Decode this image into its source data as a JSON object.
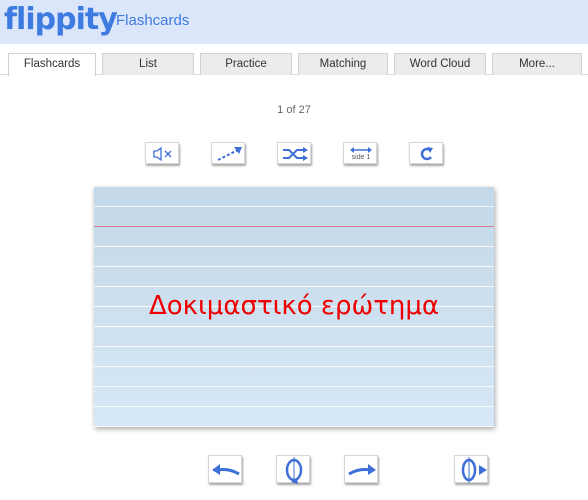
{
  "header": {
    "logo": "flippity",
    "title": "Flashcards"
  },
  "tabs": [
    {
      "label": "Flashcards",
      "active": true
    },
    {
      "label": "List"
    },
    {
      "label": "Practice"
    },
    {
      "label": "Matching"
    },
    {
      "label": "Word Cloud"
    },
    {
      "label": "More..."
    }
  ],
  "counter": "1 of 27",
  "toolbar": {
    "mute_icon": "speaker-mute-icon",
    "progress_icon": "progress-arrow-icon",
    "shuffle_icon": "shuffle-icon",
    "side_label": "side 1",
    "reset_icon": "reset-icon"
  },
  "card": {
    "text": "Δοκιμαστικό ερώτημα"
  },
  "nav": {
    "prev_icon": "left-arrow-icon",
    "flip_icon": "flip-card-icon",
    "next_icon": "right-arrow-icon",
    "flip_next_icon": "flip-next-icon"
  },
  "colors": {
    "accent": "#3d7be0",
    "card_text": "#ee0000",
    "header_bg": "#dce6fb"
  }
}
